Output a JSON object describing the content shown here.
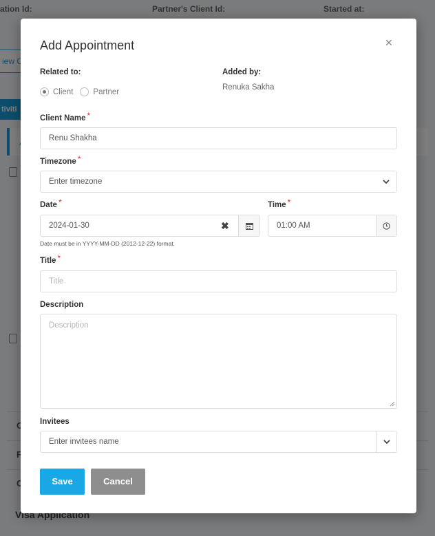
{
  "background": {
    "header_cols": [
      "ation Id:",
      "Partner's Client Id:",
      "Started at:"
    ],
    "view_button": "iew C",
    "activities_tab": "tiviti",
    "card_letter": "A",
    "row_letters": [
      "C",
      "F",
      "C"
    ],
    "footer_text": "Visa Application"
  },
  "modal": {
    "title": "Add Appointment",
    "close_icon": "close-icon",
    "related_to": {
      "label": "Related to:",
      "options": [
        {
          "label": "Client",
          "selected": true
        },
        {
          "label": "Partner",
          "selected": false
        }
      ]
    },
    "added_by": {
      "label": "Added by:",
      "value": "Renuka Sakha"
    },
    "client_name": {
      "label": "Client Name",
      "required_mark": "*",
      "value": "Renu Shakha"
    },
    "timezone": {
      "label": "Timezone",
      "required_mark": "*",
      "placeholder": "Enter timezone",
      "icon": "chevron-down-icon"
    },
    "date": {
      "label": "Date",
      "required_mark": "*",
      "value": "2024-01-30",
      "clear_icon": "clear-icon",
      "calendar_icon": "calendar-icon",
      "hint": "Date must be in YYYY-MM-DD (2012-12-22) format."
    },
    "time": {
      "label": "Time",
      "required_mark": "*",
      "value": "01:00 AM",
      "icon": "clock-icon"
    },
    "title_field": {
      "label": "Title",
      "required_mark": "*",
      "placeholder": "Title"
    },
    "description": {
      "label": "Description",
      "placeholder": "Description"
    },
    "invitees": {
      "label": "Invitees",
      "placeholder": "Enter invitees name",
      "icon": "chevron-down-icon"
    },
    "buttons": {
      "save": "Save",
      "cancel": "Cancel"
    }
  },
  "colors": {
    "primary": "#1aa7e6",
    "cancel": "#8e8e8e",
    "required": "#e02a2a"
  }
}
